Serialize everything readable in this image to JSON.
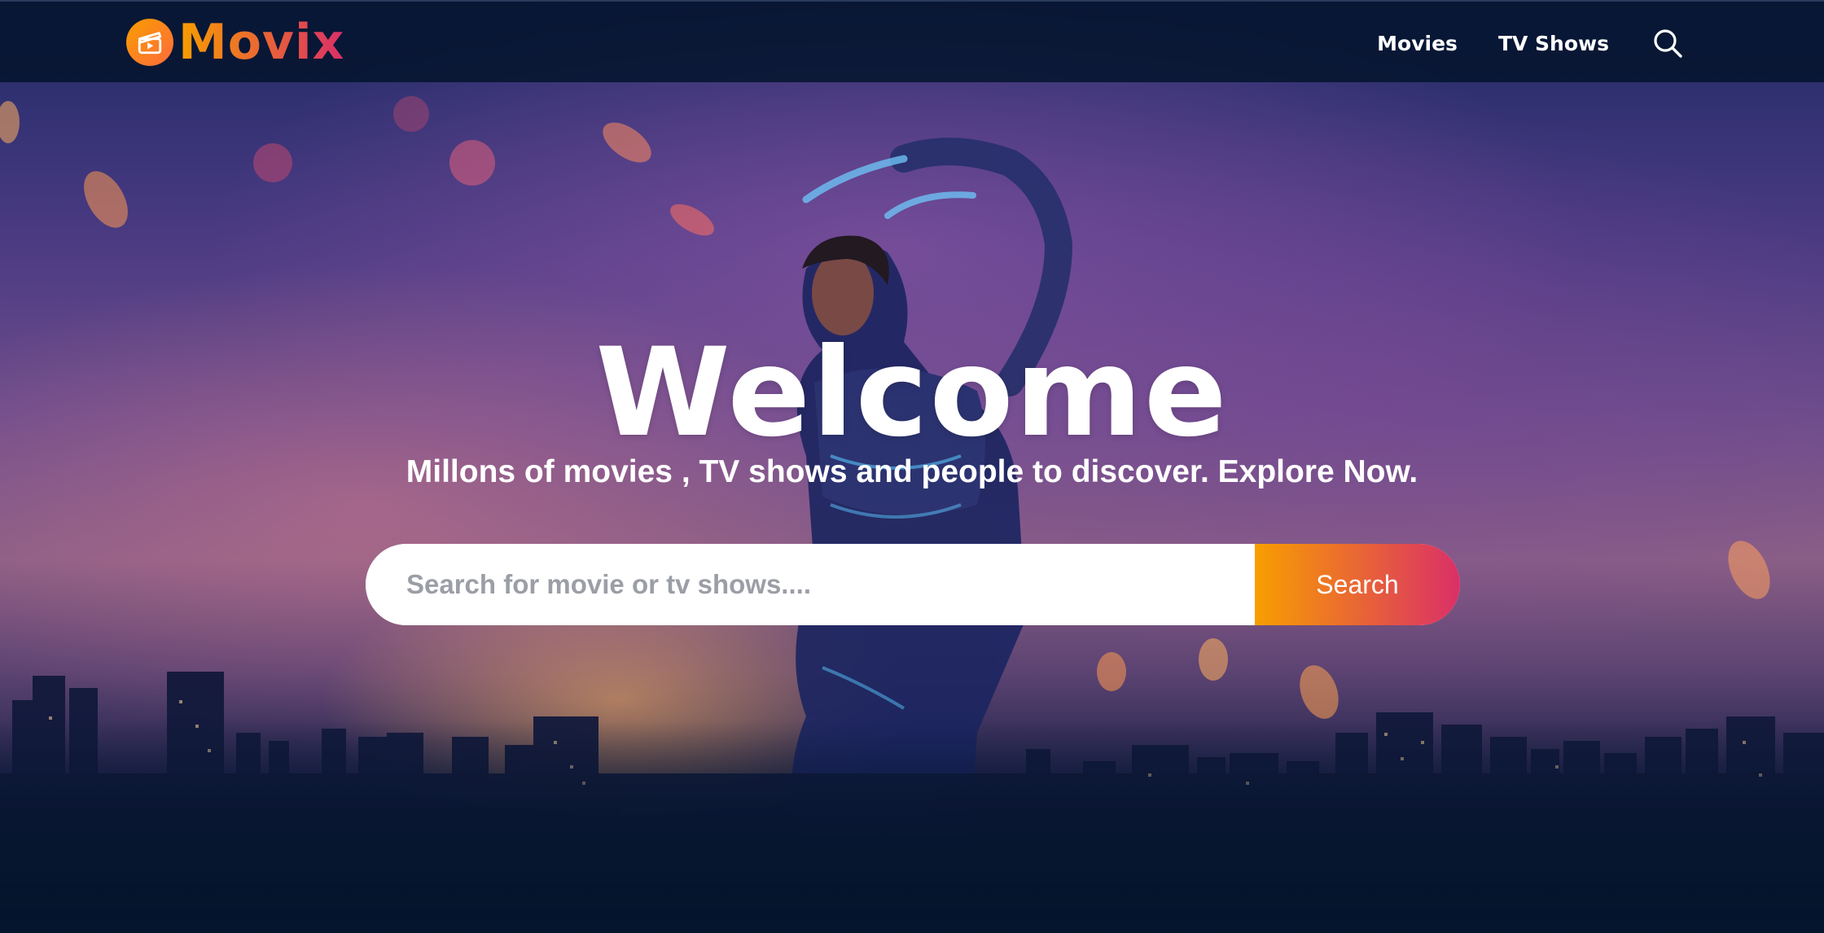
{
  "header": {
    "logo_text": "Movix",
    "nav": {
      "movies_label": "Movies",
      "tv_shows_label": "TV Shows",
      "search_icon": "search-icon"
    }
  },
  "hero": {
    "title": "Welcome",
    "subtitle": "Millons of movies , TV shows and people to discover. Explore Now.",
    "search": {
      "placeholder": "Search for movie or tv shows....",
      "value": "",
      "button_label": "Search"
    },
    "background_image": "superhero-over-city-skyline"
  },
  "colors": {
    "accent_start": "#f89e00",
    "accent_end": "#da2f68",
    "page_bg": "#04152d",
    "text": "#ffffff"
  }
}
